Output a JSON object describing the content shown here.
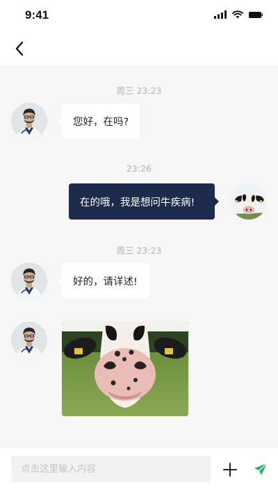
{
  "status_bar": {
    "time": "9:41"
  },
  "nav": {
    "back_icon": "chevron-left-icon"
  },
  "messages": [
    {
      "type": "time",
      "text": "周三 23:23"
    },
    {
      "type": "text",
      "direction": "incoming",
      "sender": "doctor",
      "text": "您好，在吗?"
    },
    {
      "type": "time",
      "text": "23:26"
    },
    {
      "type": "text",
      "direction": "outgoing",
      "sender": "user",
      "text": "在的哦，我是想问牛疾病!"
    },
    {
      "type": "time",
      "text": "周三 23:23"
    },
    {
      "type": "text",
      "direction": "incoming",
      "sender": "doctor",
      "text": "好的，请详述!"
    },
    {
      "type": "image",
      "direction": "incoming",
      "sender": "doctor",
      "image": "cow-nose-photo"
    }
  ],
  "input": {
    "placeholder": "点击这里输入内容"
  },
  "actions": {
    "add_icon": "plus-icon",
    "send_icon": "send-icon"
  },
  "colors": {
    "outgoing_bubble": "#1c2a4b",
    "incoming_bubble": "#ffffff",
    "chat_background": "#f6f6f6",
    "send_accent": "#21b26a"
  }
}
